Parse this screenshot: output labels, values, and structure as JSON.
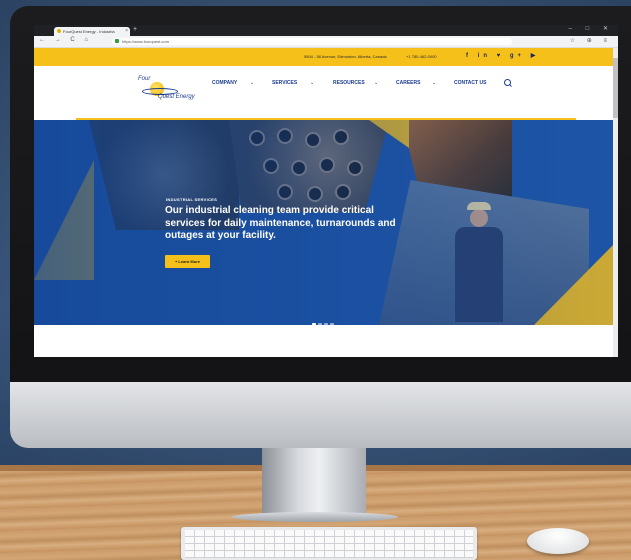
{
  "browser": {
    "tab_title": "FourQuest Energy - Industria",
    "url": "https://www.fourquest.com",
    "nav_icons": "← → C ⌂",
    "tool_icons": "☆ ⊕ ≡",
    "window_buttons": "– □ ✕"
  },
  "topbar": {
    "address": "5504 - 58 Avenue, Edmonton, Alberta, Canada",
    "phone": "+1 780-462-0000",
    "social_icons": "f in ♥ g+ ▶"
  },
  "site": {
    "logo_top": "Four",
    "logo_bottom": "Quest Energy",
    "nav": [
      {
        "label": "COMPANY"
      },
      {
        "label": "SERVICES"
      },
      {
        "label": "RESOURCES"
      },
      {
        "label": "CAREERS"
      },
      {
        "label": "CONTACT US"
      }
    ],
    "caret": "⌄"
  },
  "hero": {
    "eyebrow": "INDUSTRIAL SERVICES",
    "headline": "Our industrial cleaning team provide critical services for daily maintenance, turnarounds and outages at your facility.",
    "cta": "+ Learn More",
    "slides": 4,
    "active_slide": 1
  },
  "colors": {
    "brand_yellow": "#f6c01b",
    "brand_blue": "#1b3c8f",
    "hero_blue": "#1f56a8"
  }
}
